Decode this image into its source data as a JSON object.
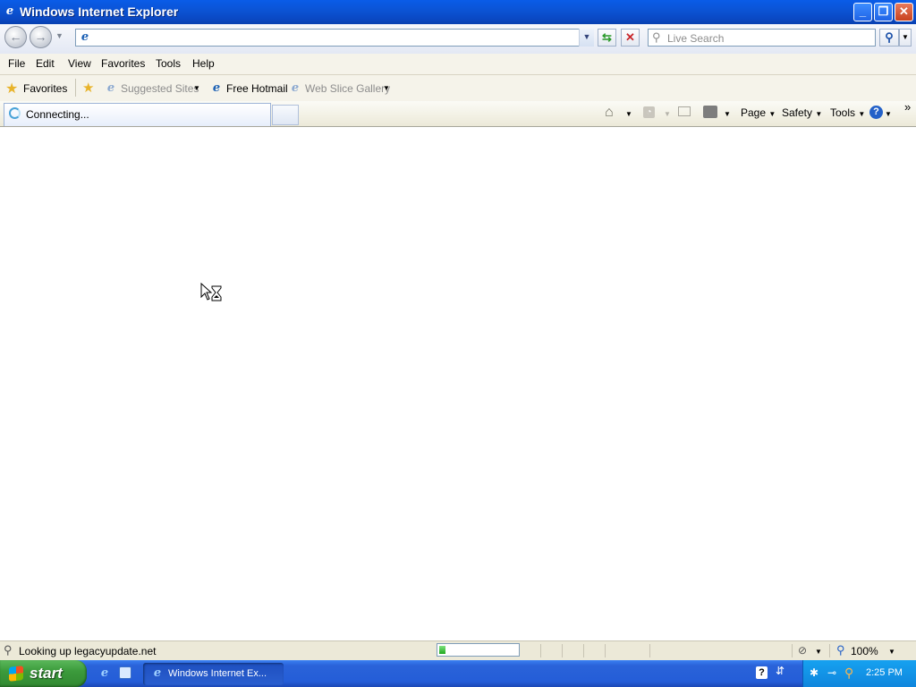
{
  "window": {
    "title": "Windows Internet Explorer",
    "minimize": "_",
    "restore": "❐",
    "close": "✕"
  },
  "address": {
    "value": "",
    "search_placeholder": "Live Search"
  },
  "menu": [
    "File",
    "Edit",
    "View",
    "Favorites",
    "Tools",
    "Help"
  ],
  "favorites_bar": {
    "favorites_label": "Favorites",
    "items": [
      {
        "label": "Suggested Sites",
        "enabled": false
      },
      {
        "label": "Free Hotmail",
        "enabled": true
      },
      {
        "label": "Web Slice Gallery",
        "enabled": false
      }
    ]
  },
  "tab": {
    "title": "Connecting..."
  },
  "command_bar": {
    "page": "Page",
    "safety": "Safety",
    "tools": "Tools"
  },
  "status": {
    "text": "Looking up legacyupdate.net",
    "progress": 0.08,
    "zoom": "100%"
  },
  "taskbar": {
    "start_label": "start",
    "task_label": "Windows Internet Ex...",
    "clock": "2:25 PM"
  },
  "colors": {
    "titlebar": "#0a5ce8",
    "taskbar": "#245dd8",
    "start": "#3c9b3c",
    "tray": "#0f86dd"
  }
}
